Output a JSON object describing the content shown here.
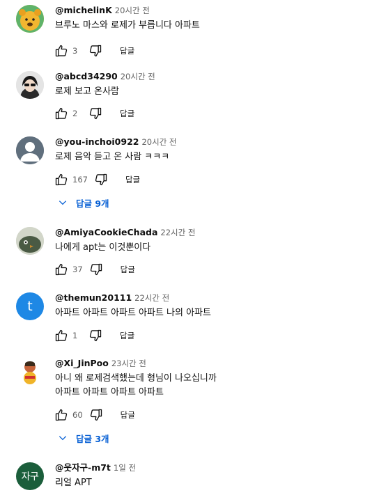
{
  "colors": {
    "link_blue": "#065fd4",
    "secondary_text": "#606060",
    "avatar_grey": "#606f7d",
    "avatar_blue": "#1e88e5",
    "avatar_green": "#1b5e3b"
  },
  "labels": {
    "reply": "답글"
  },
  "comments": [
    {
      "author": "@michelinK",
      "time": "20시간 전",
      "lines": [
        "브루노 마스와 로제가 부릅니다 아파트"
      ],
      "likes": "3",
      "avatar": "pooh-image"
    },
    {
      "author": "@abcd34290",
      "time": "20시간 전",
      "lines": [
        "로제 보고 온사람"
      ],
      "likes": "2",
      "avatar": "photo-avatar"
    },
    {
      "author": "@you-inchoi0922",
      "time": "20시간 전",
      "lines": [
        "로제 음악 듣고 온 사람 ㅋㅋㅋ"
      ],
      "likes": "167",
      "avatar": "default-person-icon",
      "replies": "답글 9개"
    },
    {
      "author": "@AmiyaCookieChada",
      "time": "22시간 전",
      "lines": [
        "나에게 apt는 이것뿐이다"
      ],
      "likes": "37",
      "avatar": "bird-image"
    },
    {
      "author": "@themun20111",
      "time": "22시간 전",
      "lines": [
        "아파트 아파트 아파트 아파트 나의 아파트"
      ],
      "likes": "1",
      "avatar": "letter-avatar",
      "avatar_letter": "t"
    },
    {
      "author": "@Xi_JinPoo",
      "time": "23시간 전",
      "lines": [
        "아니 왜 로제검색했는데 형님이 나오십니까",
        "아파트 아파트 아파트 아파트"
      ],
      "likes": "60",
      "avatar": "cartoon-image",
      "replies": "답글 3개"
    },
    {
      "author": "@웃자구-m7t",
      "time": "1일 전",
      "lines": [
        "리얼 APT"
      ],
      "avatar": "text-avatar",
      "avatar_text": "자구"
    }
  ]
}
